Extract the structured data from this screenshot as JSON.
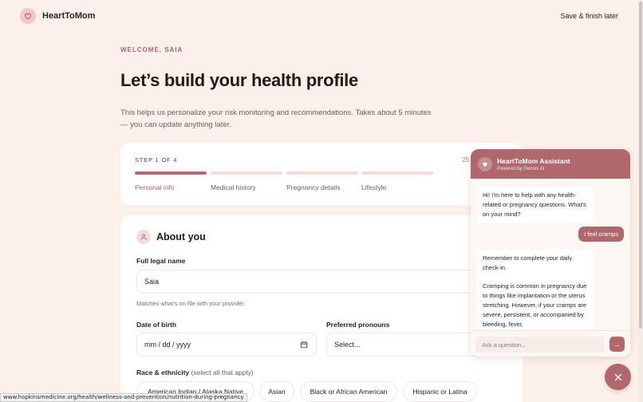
{
  "header": {
    "brand": "HeartToMom",
    "save_label": "Save & finish later"
  },
  "intro": {
    "eyebrow": "WELCOME, SAIA",
    "title": "Let’s build your health profile",
    "description": "This helps us personalize your risk monitoring and recommendations. Takes about 5 minutes — you can update anything later."
  },
  "steps": {
    "label": "STEP 1 OF 4",
    "percent": "25",
    "progress_fraction": 0.25,
    "items": [
      {
        "label": "Personal info",
        "active": true
      },
      {
        "label": "Medical history",
        "active": false
      },
      {
        "label": "Pregnancy details",
        "active": false
      },
      {
        "label": "Lifestyle",
        "active": false
      }
    ]
  },
  "about": {
    "title": "About you",
    "full_name": {
      "label": "Full legal name",
      "value": "Saia",
      "help": "Matches what’s on file with your provider."
    },
    "dob": {
      "label": "Date of birth",
      "placeholder": "mm / dd / yyyy"
    },
    "pronouns": {
      "label": "Preferred pronouns",
      "selected": "Select..."
    },
    "race": {
      "label": "Race & ethnicity",
      "sublabel": "(select all that apply)",
      "options": [
        "American Indian / Alaska Native",
        "Asian",
        "Black or African American",
        "Hispanic or Latina"
      ]
    }
  },
  "status_url": "www.hopkinsmedicine.org/health/wellness-and-prevention/nutrition-during-pregnancy",
  "chat": {
    "title": "HeartToMom Assistant",
    "subtitle": "Powered by Gemini AI",
    "messages": [
      {
        "from": "bot",
        "text": "Hi! I'm here to help with any health-related or pregnancy questions. What's on your mind?"
      },
      {
        "from": "user",
        "text": "I feel cramps"
      },
      {
        "from": "bot",
        "text": "Remember to complete your daily check-in.\n\nCramping is common in pregnancy due to things like implantation or the uterus stretching. However, if your cramps are severe, persistent, or accompanied by bleeding, fever,"
      }
    ],
    "input_placeholder": "Ask a question...",
    "send_glyph": "→"
  },
  "colors": {
    "background": "#fcf1ea",
    "accent": "#b0686d",
    "accent_light": "#f5d9d8"
  }
}
